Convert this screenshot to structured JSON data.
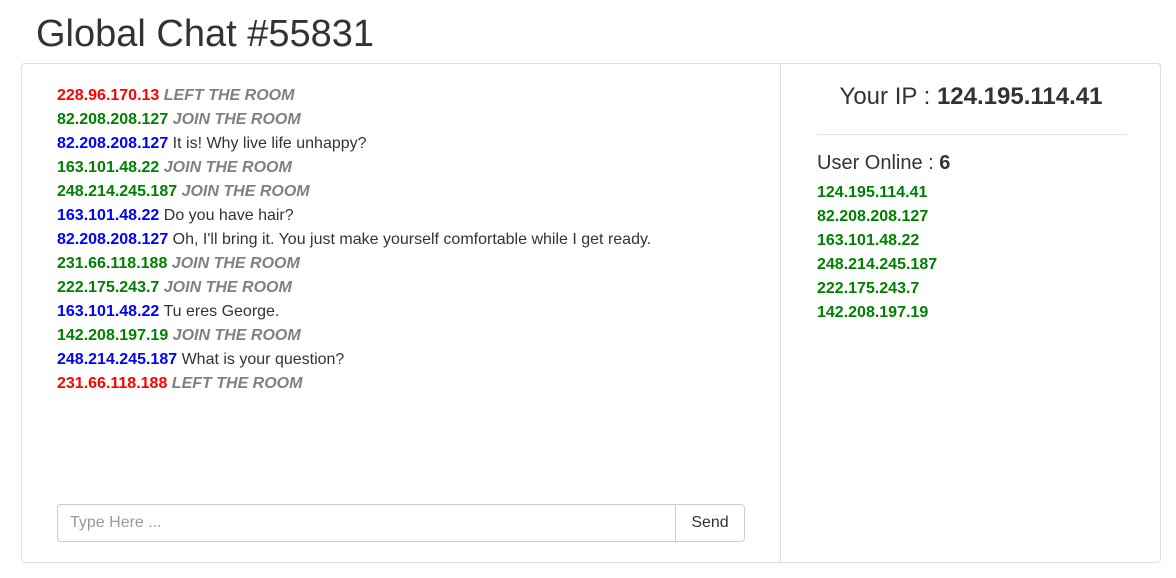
{
  "header": {
    "title": "Global Chat #55831"
  },
  "chat": {
    "messages": [
      {
        "ip": "228.96.170.13",
        "kind": "left",
        "text": "LEFT THE ROOM"
      },
      {
        "ip": "82.208.208.127",
        "kind": "join",
        "text": "JOIN THE ROOM"
      },
      {
        "ip": "82.208.208.127",
        "kind": "chat",
        "text": "It is! Why live life unhappy?"
      },
      {
        "ip": "163.101.48.22",
        "kind": "join",
        "text": "JOIN THE ROOM"
      },
      {
        "ip": "248.214.245.187",
        "kind": "join",
        "text": "JOIN THE ROOM"
      },
      {
        "ip": "163.101.48.22",
        "kind": "chat",
        "text": "Do you have hair?"
      },
      {
        "ip": "82.208.208.127",
        "kind": "chat",
        "text": "Oh, I'll bring it. You just make yourself comfortable while I get ready."
      },
      {
        "ip": "231.66.118.188",
        "kind": "join",
        "text": "JOIN THE ROOM"
      },
      {
        "ip": "222.175.243.7",
        "kind": "join",
        "text": "JOIN THE ROOM"
      },
      {
        "ip": "163.101.48.22",
        "kind": "chat",
        "text": "Tu eres George."
      },
      {
        "ip": "142.208.197.19",
        "kind": "join",
        "text": "JOIN THE ROOM"
      },
      {
        "ip": "248.214.245.187",
        "kind": "chat",
        "text": "What is your question?"
      },
      {
        "ip": "231.66.118.188",
        "kind": "left",
        "text": "LEFT THE ROOM"
      }
    ],
    "input": {
      "placeholder": "Type Here ...",
      "value": ""
    },
    "send_label": "Send"
  },
  "sidebar": {
    "your_ip_label": "Your IP : ",
    "your_ip": "124.195.114.41",
    "online_label": "User Online : ",
    "online_count": "6",
    "users": [
      "124.195.114.41",
      "82.208.208.127",
      "163.101.48.22",
      "248.214.245.187",
      "222.175.243.7",
      "142.208.197.19"
    ]
  },
  "colors": {
    "join": "#008000",
    "left": "#ff0000",
    "chat": "#0000ff",
    "event": "#808080"
  }
}
